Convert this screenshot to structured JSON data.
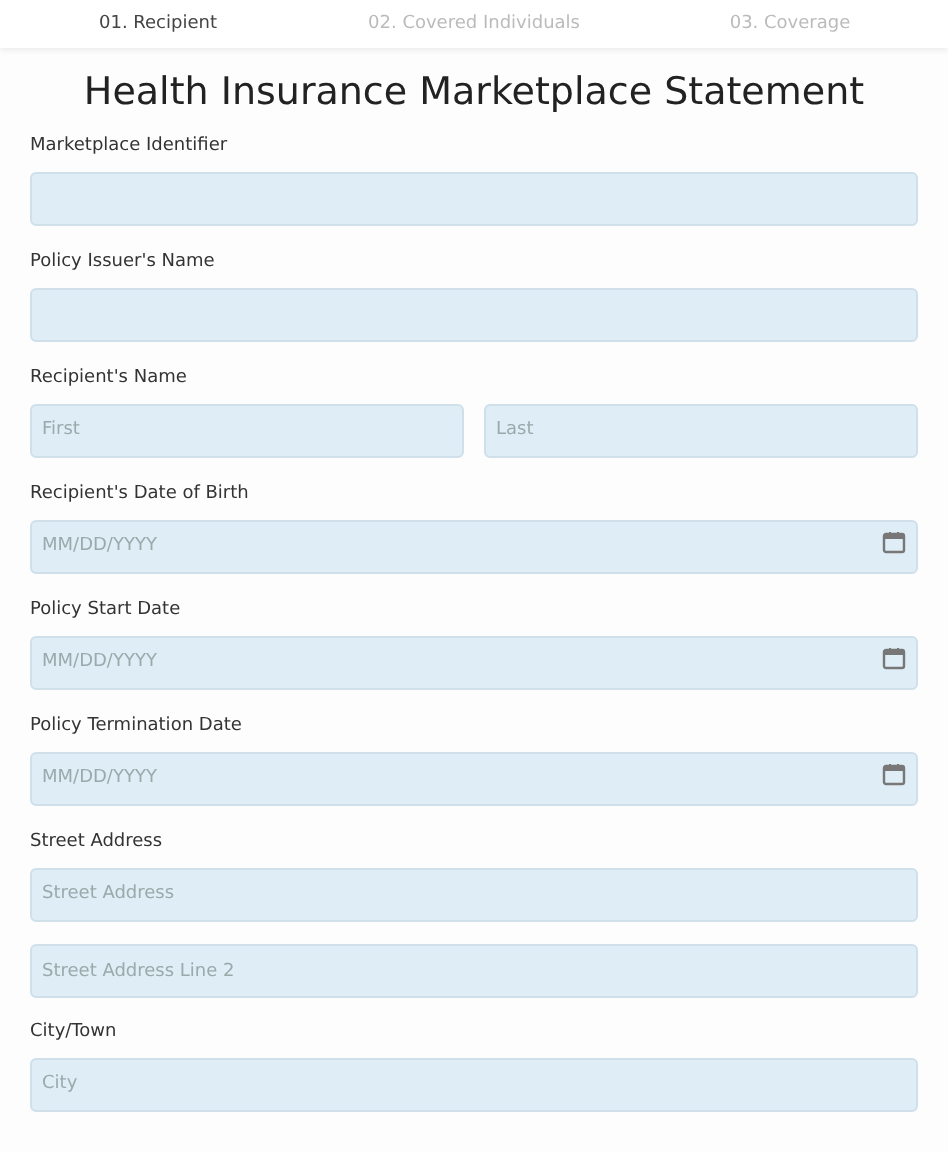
{
  "steps": [
    {
      "label": "01. Recipient",
      "selected": true
    },
    {
      "label": "02. Covered Individuals",
      "selected": false
    },
    {
      "label": "03. Coverage",
      "selected": false
    }
  ],
  "title": "Health Insurance Marketplace Statement",
  "fields": [
    {
      "label": "Marketplace Identifier",
      "kind": "text"
    },
    {
      "label": "Policy Issuer's Name",
      "kind": "text"
    },
    {
      "label": "Recipient's Name",
      "kind": "split",
      "inputs": [
        {
          "placeholder": "First"
        },
        {
          "placeholder": "Last"
        }
      ]
    },
    {
      "label": "Recipient's Date of Birth",
      "kind": "date",
      "inputs": [
        {
          "placeholder": "MM/DD/YYYY"
        }
      ]
    },
    {
      "label": "Policy Start Date",
      "kind": "date",
      "inputs": [
        {
          "placeholder": "MM/DD/YYYY"
        }
      ]
    },
    {
      "label": "Policy Termination Date",
      "kind": "date",
      "inputs": [
        {
          "placeholder": "MM/DD/YYYY"
        }
      ]
    },
    {
      "label": "Street Address",
      "kind": "stack",
      "inputs": [
        {
          "placeholder": "Street Address"
        },
        {
          "placeholder": "Street Address Line 2"
        }
      ]
    },
    {
      "label": "City/Town",
      "kind": "text",
      "inputs": [
        {
          "placeholder": "City"
        }
      ]
    }
  ]
}
